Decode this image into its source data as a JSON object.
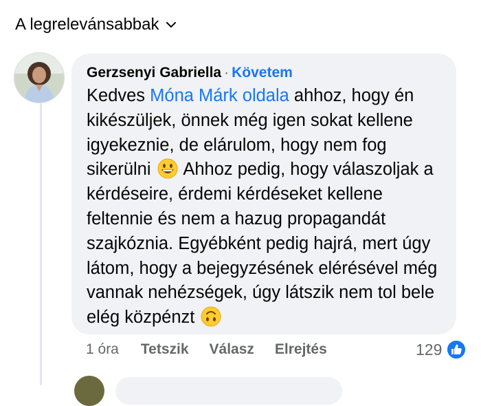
{
  "sort": {
    "label": "A legrelevánsabbak"
  },
  "comment": {
    "author": "Gerzsenyi Gabriella",
    "separator": "·",
    "follow_label": "Követem",
    "text_parts": {
      "p1": "Kedves ",
      "mention": "Móna Márk oldala",
      "p2": " ahhoz, hogy én kikészüljek, önnek még igen sokat kellene igyekeznie, de elárulom, hogy nem fog sikerülni",
      "p3": " Ahhoz pedig, hogy válaszoljak a kérdéseire, érdemi kérdéseket kellene feltennie és nem a hazug propagandát szajkóznia. Egyébként pedig hajrá, mert úgy látom, hogy a bejegyzésének elérésével még vannak nehézségek, úgy látszik nem tol bele elég közpénzt"
    },
    "emojis": [
      "grinning-face-emoji",
      "upside-down-face-emoji"
    ],
    "time": "1 óra",
    "actions": {
      "like": "Tetszik",
      "reply": "Válasz",
      "hide": "Elrejtés"
    },
    "reaction_count": "129",
    "reaction_icon": "like-icon"
  },
  "colors": {
    "link": "#1877f2",
    "bubble": "#f0f2f5",
    "meta": "#65676b"
  }
}
